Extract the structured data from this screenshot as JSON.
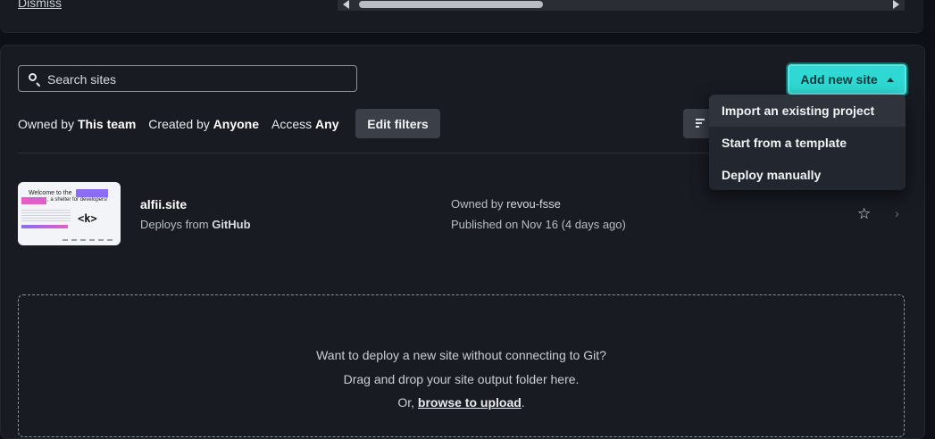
{
  "banner": {
    "dismiss_label": "Dismiss"
  },
  "search": {
    "placeholder": "Search sites"
  },
  "add_site": {
    "label": "Add new site"
  },
  "filters": {
    "owned_by_label": "Owned by",
    "owned_by_value": "This team",
    "created_by_label": "Created by",
    "created_by_value": "Anyone",
    "access_label": "Access",
    "access_value": "Any",
    "edit_label": "Edit filters"
  },
  "dropdown": {
    "items": [
      "Import an existing project",
      "Start from a template",
      "Deploy manually"
    ]
  },
  "sites": [
    {
      "name": "alfii.site",
      "deploys_prefix": "Deploys from",
      "deploys_source": "GitHub",
      "owned_prefix": "Owned by",
      "owner": "revou-fsse",
      "published": "Published on Nov 16 (4 days ago)",
      "thumbnail": {
        "line1": "Welcome to the",
        "line2": ", a shelter for developers!",
        "logo": "<k>"
      }
    }
  ],
  "dropzone": {
    "line1": "Want to deploy a new site without connecting to Git?",
    "line2": "Drag and drop your site output folder here.",
    "line3_prefix": "Or,",
    "line3_link": "browse to upload",
    "line3_suffix": "."
  },
  "icons": {
    "search": "search-icon",
    "sort": "sort-icon",
    "star": "star-icon",
    "chevron": "chevron-right-icon",
    "caret": "caret-up-icon"
  },
  "colors": {
    "accent": "#2fd8d3",
    "background": "#181b22"
  }
}
